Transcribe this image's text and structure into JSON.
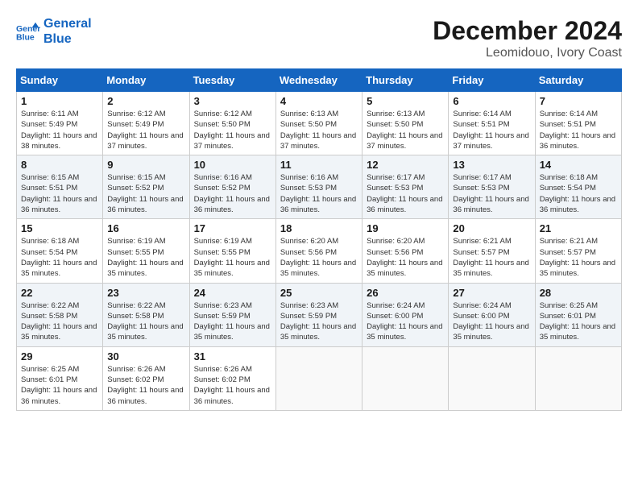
{
  "header": {
    "logo_line1": "General",
    "logo_line2": "Blue",
    "month_year": "December 2024",
    "location": "Leomidouo, Ivory Coast"
  },
  "weekdays": [
    "Sunday",
    "Monday",
    "Tuesday",
    "Wednesday",
    "Thursday",
    "Friday",
    "Saturday"
  ],
  "weeks": [
    [
      {
        "day": "1",
        "sunrise": "Sunrise: 6:11 AM",
        "sunset": "Sunset: 5:49 PM",
        "daylight": "Daylight: 11 hours and 38 minutes."
      },
      {
        "day": "2",
        "sunrise": "Sunrise: 6:12 AM",
        "sunset": "Sunset: 5:49 PM",
        "daylight": "Daylight: 11 hours and 37 minutes."
      },
      {
        "day": "3",
        "sunrise": "Sunrise: 6:12 AM",
        "sunset": "Sunset: 5:50 PM",
        "daylight": "Daylight: 11 hours and 37 minutes."
      },
      {
        "day": "4",
        "sunrise": "Sunrise: 6:13 AM",
        "sunset": "Sunset: 5:50 PM",
        "daylight": "Daylight: 11 hours and 37 minutes."
      },
      {
        "day": "5",
        "sunrise": "Sunrise: 6:13 AM",
        "sunset": "Sunset: 5:50 PM",
        "daylight": "Daylight: 11 hours and 37 minutes."
      },
      {
        "day": "6",
        "sunrise": "Sunrise: 6:14 AM",
        "sunset": "Sunset: 5:51 PM",
        "daylight": "Daylight: 11 hours and 37 minutes."
      },
      {
        "day": "7",
        "sunrise": "Sunrise: 6:14 AM",
        "sunset": "Sunset: 5:51 PM",
        "daylight": "Daylight: 11 hours and 36 minutes."
      }
    ],
    [
      {
        "day": "8",
        "sunrise": "Sunrise: 6:15 AM",
        "sunset": "Sunset: 5:51 PM",
        "daylight": "Daylight: 11 hours and 36 minutes."
      },
      {
        "day": "9",
        "sunrise": "Sunrise: 6:15 AM",
        "sunset": "Sunset: 5:52 PM",
        "daylight": "Daylight: 11 hours and 36 minutes."
      },
      {
        "day": "10",
        "sunrise": "Sunrise: 6:16 AM",
        "sunset": "Sunset: 5:52 PM",
        "daylight": "Daylight: 11 hours and 36 minutes."
      },
      {
        "day": "11",
        "sunrise": "Sunrise: 6:16 AM",
        "sunset": "Sunset: 5:53 PM",
        "daylight": "Daylight: 11 hours and 36 minutes."
      },
      {
        "day": "12",
        "sunrise": "Sunrise: 6:17 AM",
        "sunset": "Sunset: 5:53 PM",
        "daylight": "Daylight: 11 hours and 36 minutes."
      },
      {
        "day": "13",
        "sunrise": "Sunrise: 6:17 AM",
        "sunset": "Sunset: 5:53 PM",
        "daylight": "Daylight: 11 hours and 36 minutes."
      },
      {
        "day": "14",
        "sunrise": "Sunrise: 6:18 AM",
        "sunset": "Sunset: 5:54 PM",
        "daylight": "Daylight: 11 hours and 36 minutes."
      }
    ],
    [
      {
        "day": "15",
        "sunrise": "Sunrise: 6:18 AM",
        "sunset": "Sunset: 5:54 PM",
        "daylight": "Daylight: 11 hours and 35 minutes."
      },
      {
        "day": "16",
        "sunrise": "Sunrise: 6:19 AM",
        "sunset": "Sunset: 5:55 PM",
        "daylight": "Daylight: 11 hours and 35 minutes."
      },
      {
        "day": "17",
        "sunrise": "Sunrise: 6:19 AM",
        "sunset": "Sunset: 5:55 PM",
        "daylight": "Daylight: 11 hours and 35 minutes."
      },
      {
        "day": "18",
        "sunrise": "Sunrise: 6:20 AM",
        "sunset": "Sunset: 5:56 PM",
        "daylight": "Daylight: 11 hours and 35 minutes."
      },
      {
        "day": "19",
        "sunrise": "Sunrise: 6:20 AM",
        "sunset": "Sunset: 5:56 PM",
        "daylight": "Daylight: 11 hours and 35 minutes."
      },
      {
        "day": "20",
        "sunrise": "Sunrise: 6:21 AM",
        "sunset": "Sunset: 5:57 PM",
        "daylight": "Daylight: 11 hours and 35 minutes."
      },
      {
        "day": "21",
        "sunrise": "Sunrise: 6:21 AM",
        "sunset": "Sunset: 5:57 PM",
        "daylight": "Daylight: 11 hours and 35 minutes."
      }
    ],
    [
      {
        "day": "22",
        "sunrise": "Sunrise: 6:22 AM",
        "sunset": "Sunset: 5:58 PM",
        "daylight": "Daylight: 11 hours and 35 minutes."
      },
      {
        "day": "23",
        "sunrise": "Sunrise: 6:22 AM",
        "sunset": "Sunset: 5:58 PM",
        "daylight": "Daylight: 11 hours and 35 minutes."
      },
      {
        "day": "24",
        "sunrise": "Sunrise: 6:23 AM",
        "sunset": "Sunset: 5:59 PM",
        "daylight": "Daylight: 11 hours and 35 minutes."
      },
      {
        "day": "25",
        "sunrise": "Sunrise: 6:23 AM",
        "sunset": "Sunset: 5:59 PM",
        "daylight": "Daylight: 11 hours and 35 minutes."
      },
      {
        "day": "26",
        "sunrise": "Sunrise: 6:24 AM",
        "sunset": "Sunset: 6:00 PM",
        "daylight": "Daylight: 11 hours and 35 minutes."
      },
      {
        "day": "27",
        "sunrise": "Sunrise: 6:24 AM",
        "sunset": "Sunset: 6:00 PM",
        "daylight": "Daylight: 11 hours and 35 minutes."
      },
      {
        "day": "28",
        "sunrise": "Sunrise: 6:25 AM",
        "sunset": "Sunset: 6:01 PM",
        "daylight": "Daylight: 11 hours and 35 minutes."
      }
    ],
    [
      {
        "day": "29",
        "sunrise": "Sunrise: 6:25 AM",
        "sunset": "Sunset: 6:01 PM",
        "daylight": "Daylight: 11 hours and 36 minutes."
      },
      {
        "day": "30",
        "sunrise": "Sunrise: 6:26 AM",
        "sunset": "Sunset: 6:02 PM",
        "daylight": "Daylight: 11 hours and 36 minutes."
      },
      {
        "day": "31",
        "sunrise": "Sunrise: 6:26 AM",
        "sunset": "Sunset: 6:02 PM",
        "daylight": "Daylight: 11 hours and 36 minutes."
      },
      null,
      null,
      null,
      null
    ]
  ]
}
